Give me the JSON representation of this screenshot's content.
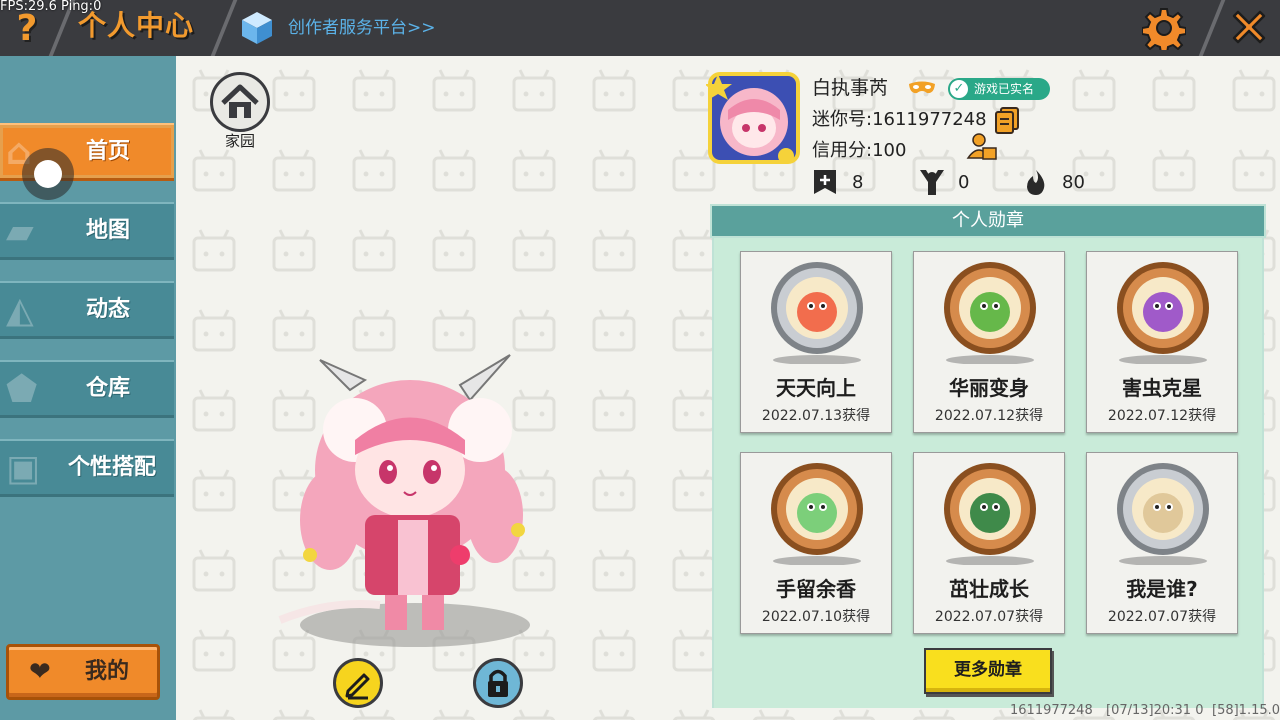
{
  "header": {
    "fps_text": "FPS:29.6  Ping:0",
    "help_icon": "question-mark",
    "title": "个人中心",
    "creator_link": "创作者服务平台>>",
    "settings_icon": "gear-icon",
    "close_icon": "close-icon"
  },
  "sidebar": {
    "items": [
      {
        "label": "首页",
        "icon": "home-icon",
        "active": true
      },
      {
        "label": "地图",
        "icon": "map-icon",
        "active": false
      },
      {
        "label": "动态",
        "icon": "bell-icon",
        "active": false
      },
      {
        "label": "仓库",
        "icon": "warehouse-icon",
        "active": false
      },
      {
        "label": "个性搭配",
        "icon": "outfit-icon",
        "active": false
      }
    ],
    "mine_label": "我的",
    "mine_icon": "heart-icon"
  },
  "main": {
    "home_label": "家园",
    "edit_icon": "pencil-icon",
    "lock_icon": "lock-icon"
  },
  "profile": {
    "nickname": "白执事芮",
    "realname_badge": "游戏已实名",
    "mini_id": "迷你号:1611977248",
    "credit": "信用分:100",
    "stats": [
      {
        "icon": "bookmark-plus-icon",
        "value": "8"
      },
      {
        "icon": "cheer-icon",
        "value": "0"
      },
      {
        "icon": "fire-icon",
        "value": "80"
      }
    ]
  },
  "badges": {
    "title": "个人勋章",
    "items": [
      {
        "name": "天天向上",
        "date": "2022.07.13获得",
        "frame": "silver",
        "theme": "calendar"
      },
      {
        "name": "华丽变身",
        "date": "2022.07.12获得",
        "frame": "bronze",
        "theme": "dino"
      },
      {
        "name": "害虫克星",
        "date": "2022.07.12获得",
        "frame": "bronze",
        "theme": "bug"
      },
      {
        "name": "手留余香",
        "date": "2022.07.10获得",
        "frame": "bronze",
        "theme": "frog"
      },
      {
        "name": "茁壮成长",
        "date": "2022.07.07获得",
        "frame": "bronze",
        "theme": "turtle"
      },
      {
        "name": "我是谁?",
        "date": "2022.07.07获得",
        "frame": "silver",
        "theme": "letter"
      }
    ],
    "more_label": "更多勋章"
  },
  "footer": {
    "id": "1611977248",
    "time": "[07/13]20:31 0",
    "version": "[58]1.15.0"
  },
  "colors": {
    "accent_orange": "#f08a2a",
    "sidebar_teal": "#488a96",
    "panel_green": "#c9ebd9",
    "header_dark": "#3a3b3f"
  }
}
